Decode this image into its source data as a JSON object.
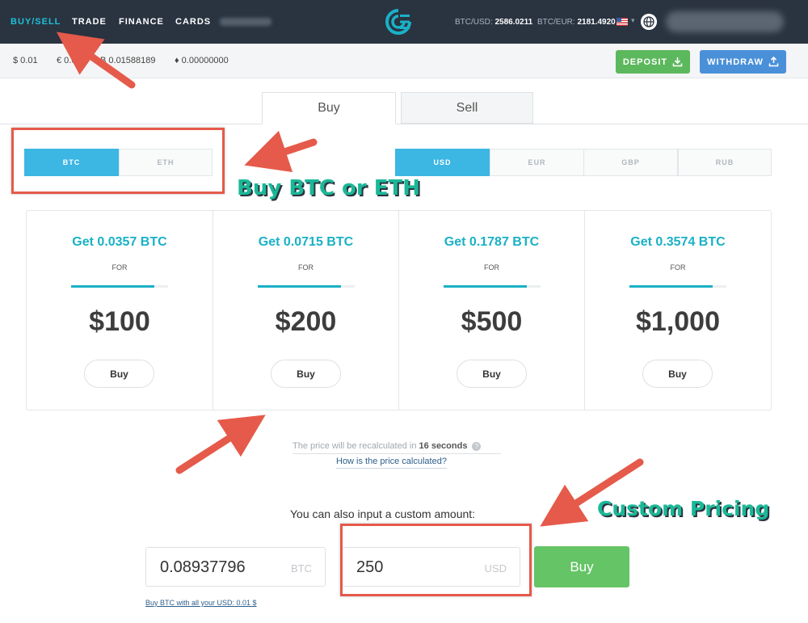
{
  "nav": {
    "items": [
      "BUY/SELL",
      "TRADE",
      "FINANCE",
      "CARDS"
    ],
    "btc_usd_label": "BTC/USD:",
    "btc_usd_value": "2586.0211",
    "btc_eur_label": "BTC/EUR:",
    "btc_eur_value": "2181.4920"
  },
  "balances": {
    "usd": "$ 0.01",
    "eur": "€ 0.00",
    "btc": "Ƀ 0.01588189",
    "eth": "♦ 0.00000000"
  },
  "actions": {
    "deposit": "DEPOSIT",
    "withdraw": "WITHDRAW"
  },
  "tabs": {
    "buy": "Buy",
    "sell": "Sell"
  },
  "crypto": {
    "btc": "BTC",
    "eth": "ETH",
    "selected": "BTC"
  },
  "currencies": {
    "usd": "USD",
    "eur": "EUR",
    "gbp": "GBP",
    "rub": "RUB",
    "selected": "USD"
  },
  "offers": [
    {
      "get": "Get 0.0357 BTC",
      "for": "FOR",
      "price": "$100",
      "button": "Buy"
    },
    {
      "get": "Get 0.0715 BTC",
      "for": "FOR",
      "price": "$200",
      "button": "Buy"
    },
    {
      "get": "Get 0.1787 BTC",
      "for": "FOR",
      "price": "$500",
      "button": "Buy"
    },
    {
      "get": "Get 0.3574 BTC",
      "for": "FOR",
      "price": "$1,000",
      "button": "Buy"
    }
  ],
  "recalc": {
    "prefix": "The price will be recalculated in",
    "time": "16 seconds",
    "help": "How is the price calculated?"
  },
  "custom": {
    "label": "You can also input a custom amount:",
    "btc_value": "0.08937796",
    "btc_unit": "BTC",
    "usd_value": "250",
    "usd_unit": "USD",
    "buy": "Buy",
    "buy_all": "Buy BTC with all your USD: 0.01 $"
  },
  "annotations": {
    "crypto_choice": "Buy BTC or ETH",
    "custom_pricing": "Custom Pricing"
  },
  "colors": {
    "nav_bg": "#2a3340",
    "accent": "#19b1c6",
    "selected": "#3cb6e3",
    "deposit": "#5cb85c",
    "withdraw": "#4a90d9",
    "annotation": "#e55a4a"
  }
}
